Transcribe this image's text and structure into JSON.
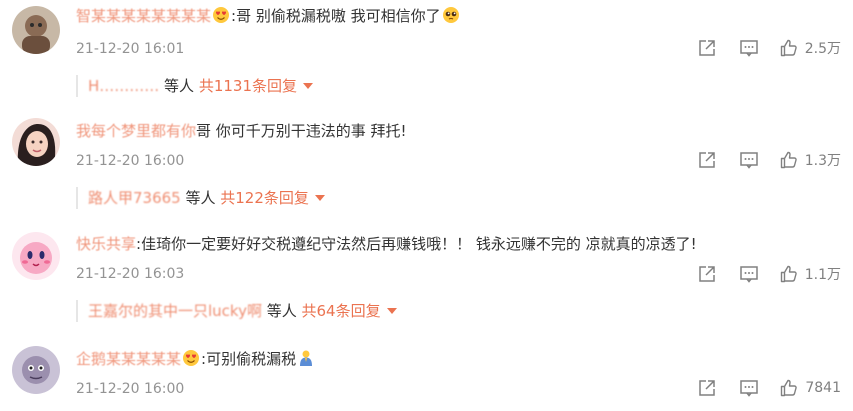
{
  "comments": [
    {
      "username": "智某某某某某某某某",
      "colon_text": ":哥 别偷税漏税嗷 我可相信你了",
      "time": "21-12-20 16:01",
      "likes": "2.5万",
      "reply": {
        "names": "H…………",
        "mid": " 等人 ",
        "count": "共1131条回复"
      }
    },
    {
      "username": "我每个梦里都有你",
      "colon_text": "哥 你可千万别干违法的事 拜托!",
      "time": "21-12-20 16:00",
      "likes": "1.3万",
      "reply": {
        "names": "路人甲73665",
        "mid": " 等人 ",
        "count": "共122条回复"
      }
    },
    {
      "username": "快乐共享",
      "colon_text": ":佳琦你一定要好好交税遵纪守法然后再赚钱哦！！ 钱永远赚不完的 凉就真的凉透了!",
      "time": "21-12-20 16:03",
      "likes": "1.1万",
      "reply": {
        "names": "王嘉尔的其中一只lucky啊",
        "mid": " 等人 ",
        "count": "共64条回复"
      }
    },
    {
      "username": "企鹅某某某某某",
      "colon_text": ":可别偷税漏税",
      "time": "21-12-20 16:00",
      "likes": "7841"
    }
  ],
  "icons": {
    "share": "share-icon",
    "comment": "comment-icon",
    "like": "thumbs-up-icon"
  },
  "colors": {
    "link": "#eb7350",
    "meta": "#939393",
    "text": "#333333"
  }
}
